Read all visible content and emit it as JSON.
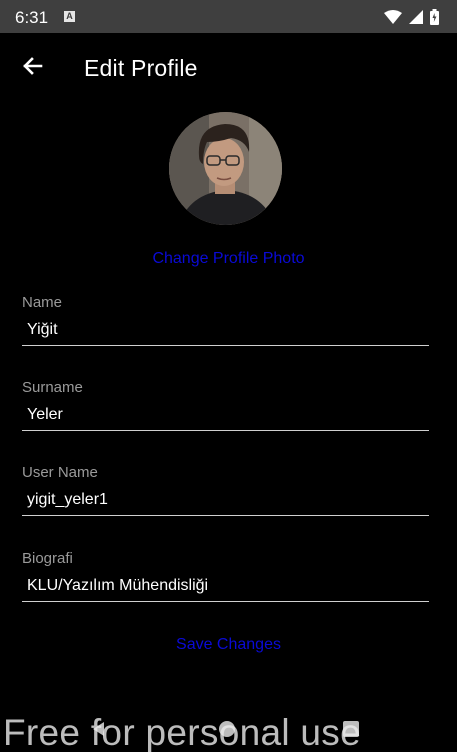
{
  "status_bar": {
    "time": "6:31",
    "notification_badge": "A",
    "icons": [
      "wifi-icon",
      "cell-signal-icon",
      "battery-icon"
    ]
  },
  "app_bar": {
    "title": "Edit Profile",
    "back_icon": "arrow-left-icon"
  },
  "profile": {
    "change_photo_label": "Change Profile Photo"
  },
  "fields": {
    "name": {
      "label": "Name",
      "value": "Yiğit"
    },
    "surname": {
      "label": "Surname",
      "value": "Yeler"
    },
    "username": {
      "label": "User Name",
      "value": "yigit_yeler1"
    },
    "biography": {
      "label": "Biografi",
      "value": "KLU/Yazılım Mühendisliği"
    }
  },
  "actions": {
    "save_label": "Save Changes"
  },
  "watermark": "Free for personal use",
  "colors": {
    "background": "#000000",
    "status_bar": "#3f3f3f",
    "link": "#0a0ad6",
    "label": "#9a9a9a",
    "underline": "#d0d0d0"
  }
}
